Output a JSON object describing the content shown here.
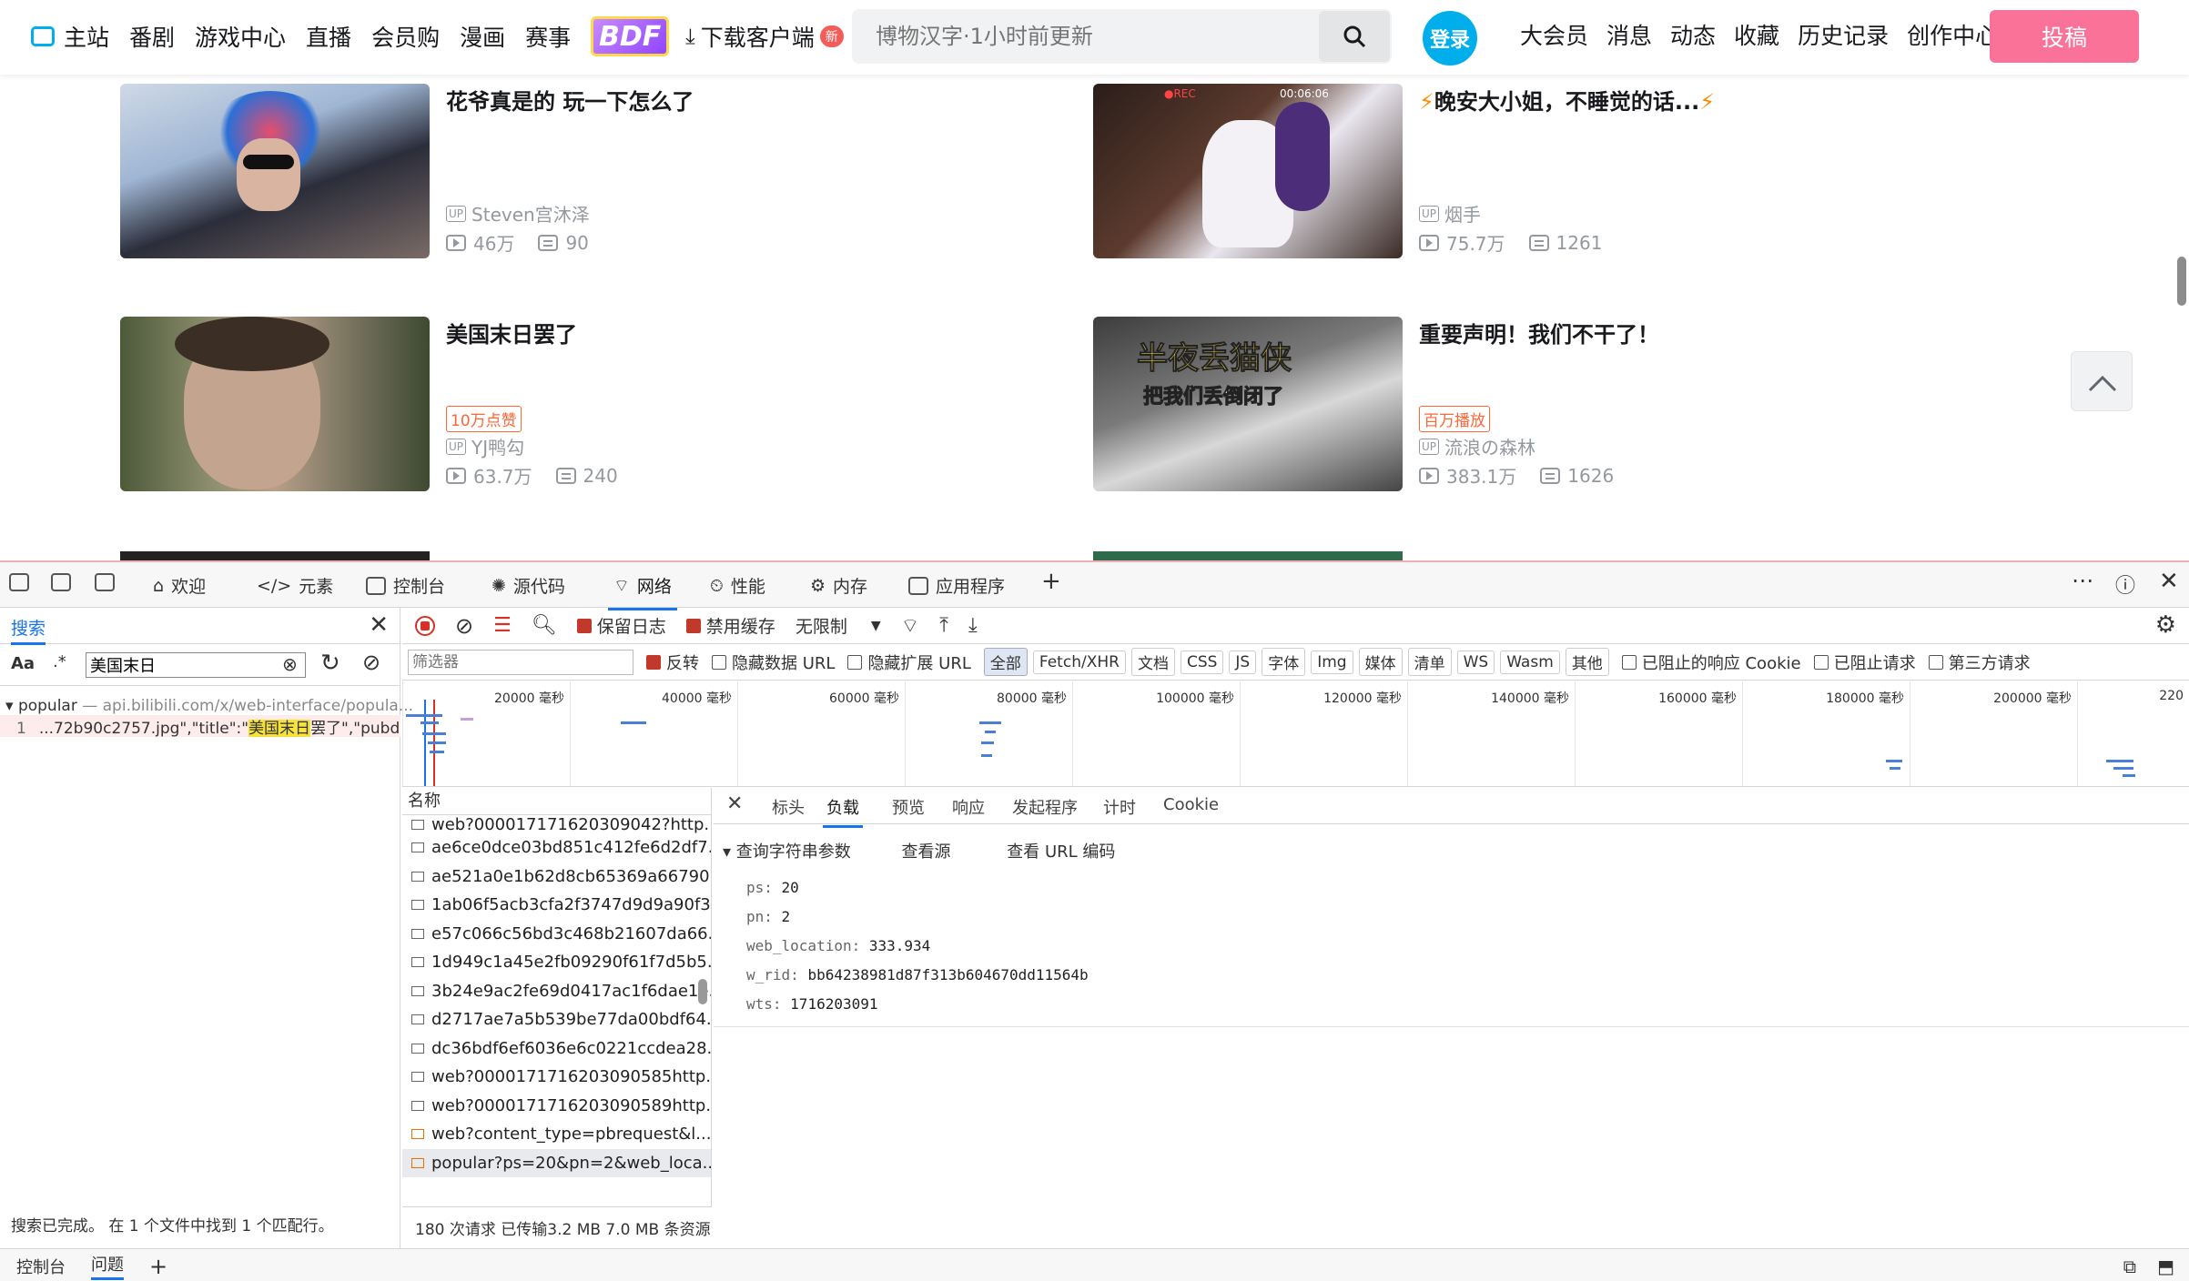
{
  "nav": {
    "home_label": "主站",
    "items": [
      "番剧",
      "游戏中心",
      "直播",
      "会员购",
      "漫画",
      "赛事"
    ],
    "bdf_label": "BDF",
    "download_label": "下载客户端",
    "download_badge": "新"
  },
  "search": {
    "placeholder": "博物汉字·1小时前更新"
  },
  "login_label": "登录",
  "right_nav": [
    "大会员",
    "消息",
    "动态",
    "收藏",
    "历史记录",
    "创作中心"
  ],
  "upload_label": "投稿",
  "cards": [
    {
      "title": "花爷真是的 玩一下怎么了",
      "tag": "",
      "uploader": "Steven宫沐泽",
      "views": "46万",
      "danmaku": "90"
    },
    {
      "title": "晚安大小姐，不睡觉的话...",
      "tag": "",
      "uploader": "烟手",
      "views": "75.7万",
      "danmaku": "1261",
      "thumb_overlay": {
        "rec": "●REC",
        "time": "00:06:06"
      }
    },
    {
      "title": "美国末日罢了",
      "tag": "10万点赞",
      "uploader": "YJ鸭勾",
      "views": "63.7万",
      "danmaku": "240"
    },
    {
      "title": "重要声明！我们不干了！",
      "tag": "百万播放",
      "uploader": "流浪の森林",
      "views": "383.1万",
      "danmaku": "1626",
      "thumb_text": [
        "半夜丢猫侠",
        "把我们丢倒闭了"
      ]
    }
  ],
  "devtools": {
    "tabs": [
      "欢迎",
      "元素",
      "控制台",
      "源代码",
      "网络",
      "性能",
      "内存",
      "应用程序"
    ],
    "active_tab": "网络",
    "search_panel": {
      "title": "搜索",
      "case_label": "Aa",
      "regex_label": ".*",
      "query": "美国末日",
      "result_file": "popular",
      "result_url": "— api.bilibili.com/x/web-interface/popula...",
      "result_line": "1",
      "result_before": "...72b90c2757.jpg\",\"title\":\"",
      "result_match": "美国末日",
      "result_after": "罢了\",\"pubda...",
      "status": "搜索已完成。  在 1 个文件中找到 1 个匹配行。"
    },
    "toolbar": {
      "preserve_log": "保留日志",
      "disable_cache": "禁用缓存",
      "throttle": "无限制"
    },
    "filters": {
      "placeholder": "筛选器",
      "invert": "反转",
      "hide_data_url": "隐藏数据 URL",
      "hide_ext_url": "隐藏扩展 URL",
      "types": [
        "全部",
        "Fetch/XHR",
        "文档",
        "CSS",
        "JS",
        "字体",
        "Img",
        "媒体",
        "清单",
        "WS",
        "Wasm",
        "其他"
      ],
      "blocked_cookies": "已阻止的响应 Cookie",
      "blocked_requests": "已阻止请求",
      "third_party": "第三方请求"
    },
    "timeline_ticks": [
      "20000 毫秒",
      "40000 毫秒",
      "60000 毫秒",
      "80000 毫秒",
      "100000 毫秒",
      "120000 毫秒",
      "140000 毫秒",
      "160000 毫秒",
      "180000 毫秒",
      "200000 毫秒",
      "220"
    ],
    "requests_header": "名称",
    "requests": [
      "web?000017171620309042?http...",
      "ae6ce0dce03bd851c412fe6d2df7...",
      "ae521a0e1b62d8cb65369a66790...",
      "1ab06f5acb3cfa2f3747d9d9a90f3...",
      "e57c066c56bd3c468b21607da66...",
      "1d949c1a45e2fb09290f61f7d5b5...",
      "3b24e9ac2fe69d0417ac1f6dae1e...",
      "d2717ae7a5b539be77da00bdf64...",
      "dc36bdf6ef6036e6c0221ccdea28...",
      "web?0000171716203090585http...",
      "web?0000171716203090589http...",
      "web?content_type=pbrequest&l...",
      "popular?ps=20&pn=2&web_loca..."
    ],
    "summary": "180 次请求  已传输3.2 MB  7.0 MB 条资源",
    "detail_tabs": [
      "标头",
      "负载",
      "预览",
      "响应",
      "发起程序",
      "计时",
      "Cookie"
    ],
    "active_detail_tab": "负载",
    "payload": {
      "section": "查询字符串参数",
      "view_source": "查看源",
      "view_url_encoded": "查看 URL 编码",
      "params": [
        {
          "key": "ps:",
          "value": "20"
        },
        {
          "key": "pn:",
          "value": "2"
        },
        {
          "key": "web_location:",
          "value": "333.934"
        },
        {
          "key": "w_rid:",
          "value": "bb64238981d87f313b604670dd11564b"
        },
        {
          "key": "wts:",
          "value": "1716203091"
        }
      ]
    },
    "drawer_tabs": [
      "控制台",
      "问题"
    ]
  },
  "colors": {
    "brand_blue": "#00aeec",
    "brand_pink": "#fb7299",
    "devtools_accent": "#1a73e8"
  }
}
